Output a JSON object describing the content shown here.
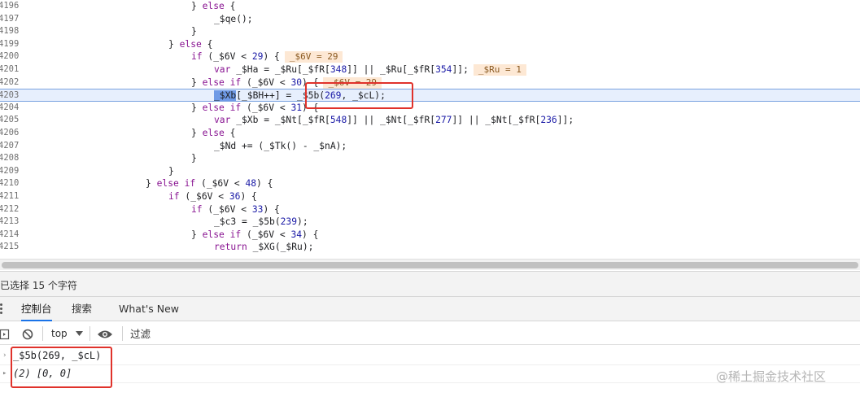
{
  "source": {
    "lines": [
      {
        "num": "4196",
        "indent": 235,
        "tokens": [
          {
            "t": "} ",
            "c": "tok"
          },
          {
            "t": "else",
            "c": "kw"
          },
          {
            "t": " {",
            "c": "tok"
          }
        ]
      },
      {
        "num": "4197",
        "indent": 263,
        "tokens": [
          {
            "t": "_$qe();",
            "c": "tok"
          }
        ]
      },
      {
        "num": "4198",
        "indent": 235,
        "tokens": [
          {
            "t": "}",
            "c": "tok"
          }
        ]
      },
      {
        "num": "4199",
        "indent": 207,
        "tokens": [
          {
            "t": "} ",
            "c": "tok"
          },
          {
            "t": "else",
            "c": "kw"
          },
          {
            "t": " {",
            "c": "tok"
          }
        ]
      },
      {
        "num": "4200",
        "indent": 235,
        "tokens": [
          {
            "t": "if",
            "c": "kw"
          },
          {
            "t": " (_$6V < ",
            "c": "tok"
          },
          {
            "t": "29",
            "c": "num"
          },
          {
            "t": ") {",
            "c": "tok"
          }
        ],
        "inline": "_$6V = 29"
      },
      {
        "num": "4201",
        "indent": 263,
        "tokens": [
          {
            "t": "var",
            "c": "kw"
          },
          {
            "t": " _$Ha = _$Ru[_$fR[",
            "c": "tok"
          },
          {
            "t": "348",
            "c": "num"
          },
          {
            "t": "]] || _$Ru[_$fR[",
            "c": "tok"
          },
          {
            "t": "354",
            "c": "num"
          },
          {
            "t": "]];",
            "c": "tok"
          }
        ],
        "inline": "_$Ru = 1"
      },
      {
        "num": "4202",
        "indent": 235,
        "tokens": [
          {
            "t": "} ",
            "c": "tok"
          },
          {
            "t": "else if",
            "c": "kw"
          },
          {
            "t": " (_$6V < ",
            "c": "tok"
          },
          {
            "t": "30",
            "c": "num"
          },
          {
            "t": ") {",
            "c": "tok"
          }
        ],
        "inline": "_$6V = 29"
      },
      {
        "num": "4203",
        "indent": 263,
        "active": true,
        "tokens": [
          {
            "t": "_$Xb",
            "c": "sel"
          },
          {
            "t": "[_$BH++] = ",
            "c": "tok"
          },
          {
            "t": "_$5b(",
            "c": "tok"
          },
          {
            "t": "269",
            "c": "num"
          },
          {
            "t": ", _$cL);",
            "c": "tok"
          }
        ]
      },
      {
        "num": "4204",
        "indent": 235,
        "tokens": [
          {
            "t": "} ",
            "c": "tok"
          },
          {
            "t": "else if",
            "c": "kw"
          },
          {
            "t": " (_$6V < ",
            "c": "tok"
          },
          {
            "t": "31",
            "c": "num"
          },
          {
            "t": ") {",
            "c": "tok"
          }
        ]
      },
      {
        "num": "4205",
        "indent": 263,
        "tokens": [
          {
            "t": "var",
            "c": "kw"
          },
          {
            "t": " _$Xb = _$Nt[_$fR[",
            "c": "tok"
          },
          {
            "t": "548",
            "c": "num"
          },
          {
            "t": "]] || _$Nt[_$fR[",
            "c": "tok"
          },
          {
            "t": "277",
            "c": "num"
          },
          {
            "t": "]] || _$Nt[_$fR[",
            "c": "tok"
          },
          {
            "t": "236",
            "c": "num"
          },
          {
            "t": "]];",
            "c": "tok"
          }
        ]
      },
      {
        "num": "4206",
        "indent": 235,
        "tokens": [
          {
            "t": "} ",
            "c": "tok"
          },
          {
            "t": "else",
            "c": "kw"
          },
          {
            "t": " {",
            "c": "tok"
          }
        ]
      },
      {
        "num": "4207",
        "indent": 263,
        "tokens": [
          {
            "t": "_$Nd += (_$Tk() - _$nA);",
            "c": "tok"
          }
        ]
      },
      {
        "num": "4208",
        "indent": 235,
        "tokens": [
          {
            "t": "}",
            "c": "tok"
          }
        ]
      },
      {
        "num": "4209",
        "indent": 207,
        "tokens": [
          {
            "t": "}",
            "c": "tok"
          }
        ]
      },
      {
        "num": "4210",
        "indent": 179,
        "tokens": [
          {
            "t": "} ",
            "c": "tok"
          },
          {
            "t": "else if",
            "c": "kw"
          },
          {
            "t": " (_$6V < ",
            "c": "tok"
          },
          {
            "t": "48",
            "c": "num"
          },
          {
            "t": ") {",
            "c": "tok"
          }
        ]
      },
      {
        "num": "4211",
        "indent": 207,
        "tokens": [
          {
            "t": "if",
            "c": "kw"
          },
          {
            "t": " (_$6V < ",
            "c": "tok"
          },
          {
            "t": "36",
            "c": "num"
          },
          {
            "t": ") {",
            "c": "tok"
          }
        ]
      },
      {
        "num": "4212",
        "indent": 235,
        "tokens": [
          {
            "t": "if",
            "c": "kw"
          },
          {
            "t": " (_$6V < ",
            "c": "tok"
          },
          {
            "t": "33",
            "c": "num"
          },
          {
            "t": ") {",
            "c": "tok"
          }
        ]
      },
      {
        "num": "4213",
        "indent": 263,
        "tokens": [
          {
            "t": "_$c3 = _$5b(",
            "c": "tok"
          },
          {
            "t": "239",
            "c": "num"
          },
          {
            "t": ");",
            "c": "tok"
          }
        ]
      },
      {
        "num": "4214",
        "indent": 235,
        "tokens": [
          {
            "t": "} ",
            "c": "tok"
          },
          {
            "t": "else if",
            "c": "kw"
          },
          {
            "t": " (_$6V < ",
            "c": "tok"
          },
          {
            "t": "34",
            "c": "num"
          },
          {
            "t": ") {",
            "c": "tok"
          }
        ]
      },
      {
        "num": "4215",
        "indent": 263,
        "tokens": [
          {
            "t": "return",
            "c": "kw"
          },
          {
            "t": " _$XG(_$Ru);",
            "c": "tok"
          }
        ]
      }
    ]
  },
  "status_bar": {
    "text": "已选择 15 个字符"
  },
  "drawer": {
    "tabs": [
      {
        "label": "控制台",
        "active": true
      },
      {
        "label": "搜索",
        "active": false
      },
      {
        "label": "What's New",
        "active": false
      }
    ]
  },
  "console_toolbar": {
    "context": "top",
    "filter_placeholder": "过滤",
    "icons": [
      "sidebar-toggle-icon",
      "clear-console-icon",
      "chevron-down-icon",
      "eye-icon"
    ]
  },
  "console": {
    "entries": [
      {
        "type": "input",
        "text": "_$5b(269, _$cL)"
      },
      {
        "type": "result",
        "text": "(2) [0, 0]"
      }
    ]
  },
  "watermark": "@稀土掘金技术社区",
  "colors": {
    "annotation": "#e0322b",
    "accent": "#1a73e8",
    "selection": "#6f9ae6",
    "active_line": "#e7effd"
  }
}
